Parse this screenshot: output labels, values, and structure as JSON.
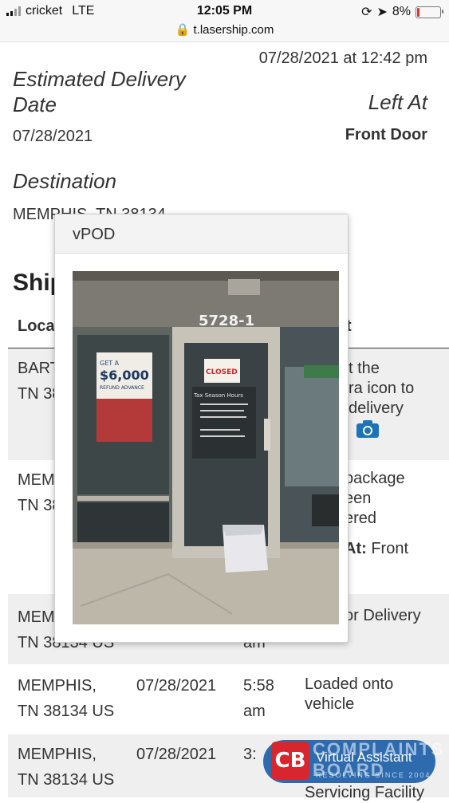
{
  "status_bar": {
    "carrier": "cricket",
    "network": "LTE",
    "time": "12:05 PM",
    "url": "t.lasership.com",
    "battery": "8%"
  },
  "summary": {
    "delivered_datetime": "07/28/2021 at 12:42 pm",
    "estimated_label": "Estimated Delivery Date",
    "estimated_line1": "Estimated Delivery",
    "estimated_line2": "Date",
    "estimated_value": "07/28/2021",
    "left_at_label": "Left At",
    "left_at_value": "Front Door",
    "destination_label": "Destination",
    "destination_value": "MEMPHIS, TN 38134"
  },
  "section": {
    "heading_partial": "Ship"
  },
  "table": {
    "col_location_partial": "Loca",
    "col_event_partial": "t",
    "rows": [
      {
        "loc1": "BART",
        "loc2": "TN 38",
        "ev1": "t the",
        "ev2": "ra icon to",
        "ev3": "delivery"
      },
      {
        "loc1": "MEM",
        "loc2": "TN 38",
        "ev1": "package",
        "ev2": "een",
        "ev3": "ered",
        "ev4_label": "At:",
        "ev4_value": "Front"
      },
      {
        "loc1": "MEM",
        "loc2": "TN 38134 US",
        "time_partial": "am",
        "ev1": "or Delivery"
      },
      {
        "loc1": "MEMPHIS,",
        "loc2": "TN 38134 US",
        "date": "07/28/2021",
        "time1": "5:58",
        "time2": "am",
        "ev1": "Loaded onto",
        "ev2": "vehicle"
      },
      {
        "loc1": "MEMPHIS,",
        "loc2": "TN 38134 US",
        "date": "07/28/2021",
        "time1": "3:",
        "ev1": "Servicing Facility"
      }
    ]
  },
  "modal": {
    "title": "vPOD",
    "photo": {
      "store_number": "5728-1",
      "sign_closed": "CLOSED",
      "sign_hours": "Tax Season Hours",
      "poster_top": "GET A",
      "poster_amount": "$6,000",
      "poster_line": "REFUND ADVANCE"
    }
  },
  "badge": {
    "logo_letters": "CB",
    "brand": "COMPLAINTS BOARD",
    "text": "Virtual Assistant",
    "sub": "RESOLVING SINCE 2004"
  },
  "colors": {
    "accent_blue": "#1c73b8",
    "badge_blue": "#1c5fa8",
    "badge_red": "#d7262e"
  }
}
